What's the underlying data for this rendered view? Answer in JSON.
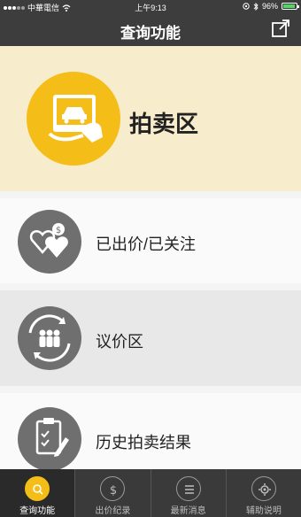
{
  "status": {
    "carrier": "中華電信",
    "time": "上午9:13",
    "battery": "96%"
  },
  "nav": {
    "title": "查询功能"
  },
  "hero": {
    "label": "拍卖区"
  },
  "menu": [
    {
      "label": "已出价/已关注"
    },
    {
      "label": "议价区"
    },
    {
      "label": "历史拍卖结果"
    }
  ],
  "tabs": [
    {
      "label": "查询功能",
      "icon": "search-icon"
    },
    {
      "label": "出价纪录",
      "icon": "dollar-icon"
    },
    {
      "label": "最新消息",
      "icon": "list-icon"
    },
    {
      "label": "辅助说明",
      "icon": "gear-icon"
    }
  ],
  "colors": {
    "accent": "#f5bd18",
    "bar": "#3d3d3d",
    "hero_bg": "#f7eccb",
    "icon_circle": "#6f6f6f"
  }
}
